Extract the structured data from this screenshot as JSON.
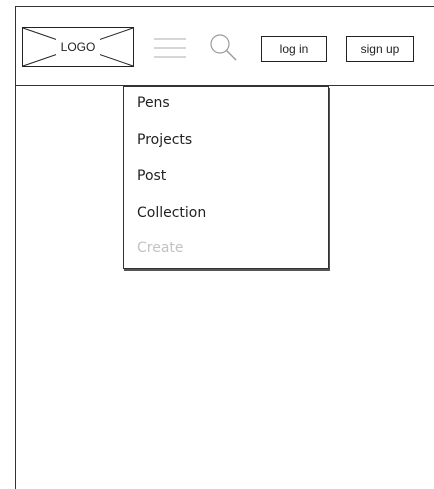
{
  "header": {
    "logo_text": "LOGO",
    "menu_icon": "hamburger-menu-icon",
    "search_icon": "search-icon",
    "login_label": "log in",
    "signup_label": "sign up"
  },
  "dropdown": {
    "items": [
      {
        "label": "Pens",
        "enabled": true
      },
      {
        "label": "Projects",
        "enabled": true
      },
      {
        "label": "Post",
        "enabled": true
      },
      {
        "label": "Collection",
        "enabled": true
      },
      {
        "label": "Create",
        "enabled": false
      }
    ]
  },
  "colors": {
    "stroke": "#222222",
    "disabled_text": "#c2c2c2",
    "menu_icon": "#bdbdbd"
  }
}
